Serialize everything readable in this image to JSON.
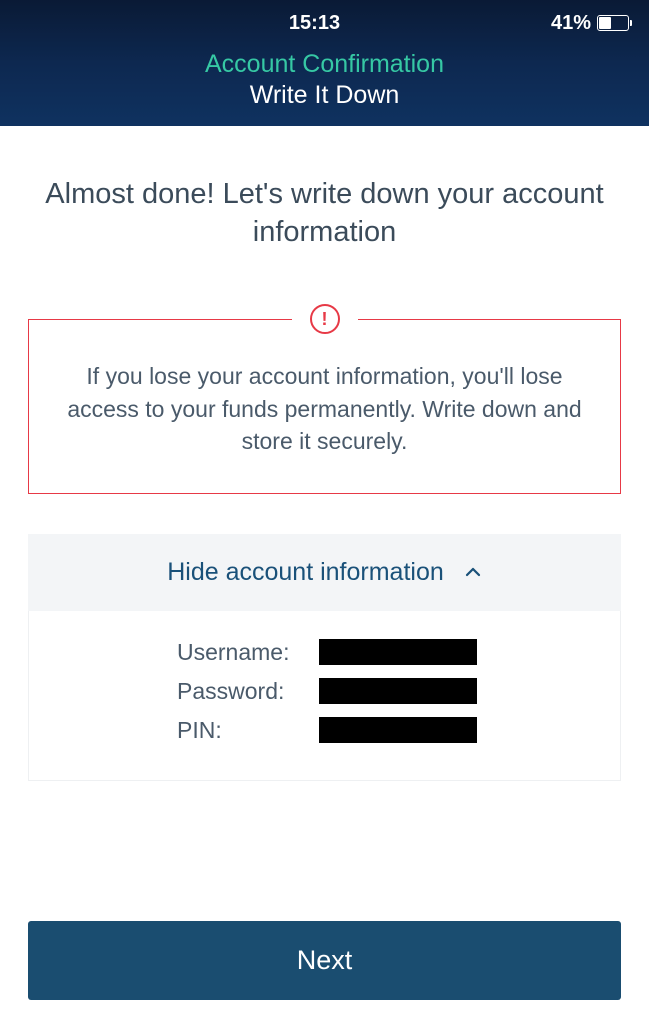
{
  "statusBar": {
    "time": "15:13",
    "batteryPercent": "41%"
  },
  "header": {
    "subtitle": "Account Confirmation",
    "title": "Write It Down"
  },
  "mainHeading": "Almost done! Let's write down your account information",
  "warning": {
    "text": "If you lose your account information, you'll lose access to your funds permanently. Write down and store it securely."
  },
  "accountPanel": {
    "toggleLabel": "Hide account information",
    "fields": {
      "username": {
        "label": "Username:"
      },
      "password": {
        "label": "Password:"
      },
      "pin": {
        "label": "PIN:"
      }
    }
  },
  "nextButton": {
    "label": "Next"
  }
}
